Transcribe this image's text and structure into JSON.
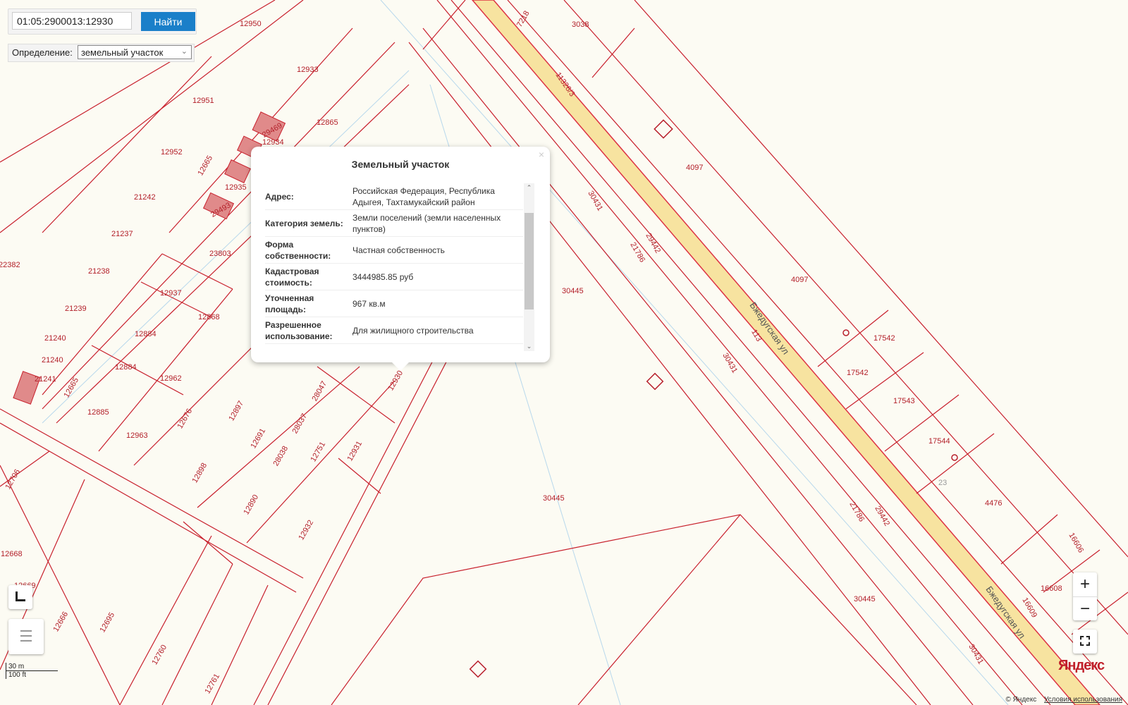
{
  "search": {
    "value": "01:05:2900013:12930",
    "button": "Найти"
  },
  "definition": {
    "label": "Определение:",
    "selected": "земельный участок"
  },
  "popup": {
    "title": "Земельный участок",
    "rows": [
      {
        "key": "Адрес:",
        "value": "Российская Федерация, Республика Адыгея, Тахтамукайский район"
      },
      {
        "key": "Категория земель:",
        "value": "Земли поселений (земли населенных пунктов)"
      },
      {
        "key": "Форма собственности:",
        "value": "Частная собственность"
      },
      {
        "key": "Кадастровая стоимость:",
        "value": "3444985.85 руб"
      },
      {
        "key": "Уточненная площадь:",
        "value": "967 кв.м"
      },
      {
        "key": "Разрешенное использование:",
        "value": "Для жилищного строительства"
      }
    ]
  },
  "map": {
    "labels": [
      "12950",
      "12933",
      "12951",
      "12865",
      "12934",
      "12952",
      "12665",
      "12935",
      "21242",
      "21237",
      "23803",
      "22382",
      "21238",
      "12937",
      "12868",
      "21239",
      "12884",
      "21240",
      "21240",
      "12884",
      "12962",
      "21241",
      "12665",
      "12930",
      "12885",
      "12963",
      "12676",
      "12897",
      "28047",
      "28037",
      "12691",
      "28038",
      "12751",
      "12931",
      "12706",
      "12898",
      "12890",
      "12932",
      "12668",
      "12669",
      "12666",
      "12695",
      "12760",
      "12761",
      "3038",
      "7218",
      "11326/3",
      "4097",
      "30431",
      "29442",
      "21786",
      "30445",
      "4097",
      "Бжедугская ул",
      "113",
      "30431",
      "17542",
      "17542",
      "17543",
      "17544",
      "23",
      "4476",
      "30445",
      "21786",
      "29442",
      "16606",
      "30445",
      "16608",
      "16609",
      "Бжедугская ул",
      "30431",
      "29493",
      "29469"
    ]
  },
  "controls": {
    "zoom_in": "+",
    "zoom_out": "−"
  },
  "scale": {
    "metric": "30 m",
    "imperial": "100 ft"
  },
  "footer": {
    "copyright": "© Яндекс",
    "terms": "Условия использования",
    "logo": "Яндекс"
  },
  "colors": {
    "parcel": "#c8202c",
    "road": "#f7e3a0",
    "button": "#1a7fc9"
  }
}
